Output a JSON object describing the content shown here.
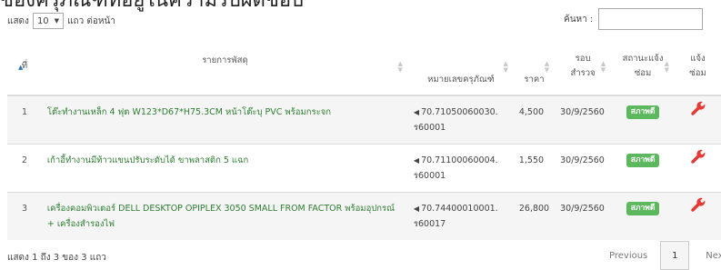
{
  "page": {
    "title": "ของครุภัณฑ์ที่อยู่ในความรับผิดชอบ"
  },
  "length_control": {
    "prefix": "แสดง",
    "selected": "10",
    "suffix": "แถว ต่อหน้า"
  },
  "search": {
    "label": "ค้นหา :",
    "value": ""
  },
  "table": {
    "headers": {
      "no": "ที่",
      "name": "รายการพัสดุ",
      "code": "หมายเลขครุภัณฑ์",
      "price": "ราคา",
      "round": "รอบ สำรวจ",
      "status": "สถานะแจ้ง ซ่อม",
      "report": "แจ้ง ซ่อม"
    },
    "sorted_column": "no",
    "rows": [
      {
        "no": "1",
        "name": "โต๊ะทำงานเหล็ก 4 ฟุต W123*D67*H75.3CM หน้าโต๊ะบุ PVC พร้อมกระจก",
        "code_line1": "70.71050060030.",
        "code_line2": "ร60001",
        "price": "4,500",
        "date": "30/9/2560",
        "status": "สภาพดี"
      },
      {
        "no": "2",
        "name": "เก้าอี้ทำงานมีท้าวแขนปรับระดับได้ ขาพลาสติก 5 แฉก",
        "code_line1": "70.71100060004.",
        "code_line2": "ร60001",
        "price": "1,550",
        "date": "30/9/2560",
        "status": "สภาพดี"
      },
      {
        "no": "3",
        "name": "เครื่องคอมพิวเตอร์ DELL DESKTOP OPIPLEX 3050 SMALL FROM FACTOR พร้อมอุปกรณ์ + เครื่องสำรองไฟ",
        "code_line1": "70.74400010001.",
        "code_line2": "ร60017",
        "price": "26,800",
        "date": "30/9/2560",
        "status": "สภาพดี"
      }
    ]
  },
  "footer": {
    "info": "แสดง 1 ถึง 3 ของ 3 แถว"
  },
  "pagination": {
    "previous": "Previous",
    "current": "1",
    "next": "Next"
  },
  "colors": {
    "link_green": "#2e7d32",
    "badge_green": "#5cb85c",
    "wrench_red": "#e53935",
    "sort_active": "#337ab7"
  },
  "icons": {
    "code_marker": "caret-left-icon",
    "report": "wrench-icon"
  }
}
